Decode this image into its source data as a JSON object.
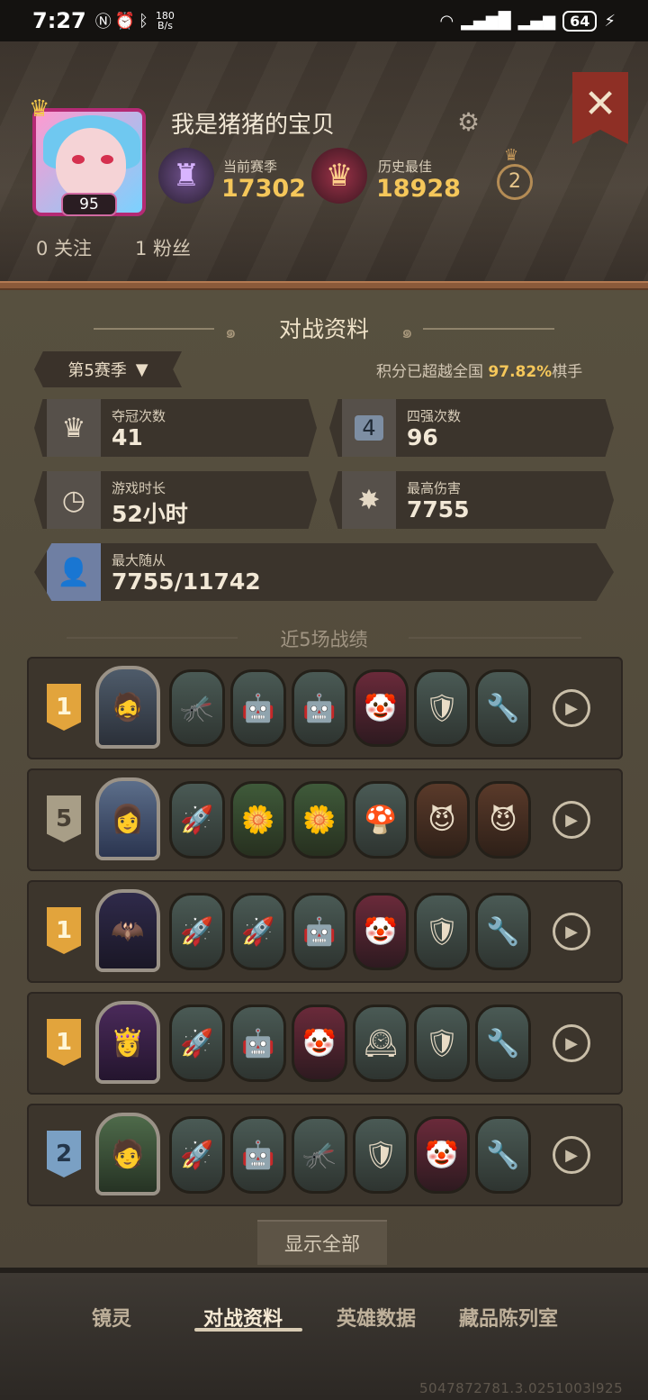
{
  "status_bar": {
    "time": "7:27",
    "network_speed_value": "180",
    "network_speed_unit": "B/s",
    "battery": "64"
  },
  "profile": {
    "username": "我是猪猪的宝贝",
    "level": "95",
    "current_season_label": "当前赛季",
    "current_season_score": "17302",
    "best_label": "历史最佳",
    "best_score": "18928",
    "battle_pass_level": "2",
    "following": "0 关注",
    "followers": "1 粉丝"
  },
  "battle_data": {
    "title": "对战资料",
    "season_selector": "第5赛季",
    "beat_prefix": "积分已超越全国",
    "beat_percent": "97.82%",
    "beat_suffix": "棋手",
    "stats": {
      "champion_label": "夺冠次数",
      "champion_value": "41",
      "top4_label": "四强次数",
      "top4_value": "96",
      "playtime_label": "游戏时长",
      "playtime_value": "52小时",
      "max_damage_label": "最高伤害",
      "max_damage_value": "7755",
      "max_minion_label": "最大随从",
      "max_minion_value": "7755/11742"
    },
    "top4_icon_digit": "4"
  },
  "recent": {
    "title": "近5场战绩",
    "matches": [
      {
        "place": "1",
        "tier": "gold"
      },
      {
        "place": "5",
        "tier": "grey"
      },
      {
        "place": "1",
        "tier": "gold"
      },
      {
        "place": "1",
        "tier": "gold"
      },
      {
        "place": "2",
        "tier": "blue"
      }
    ],
    "show_all": "显示全部"
  },
  "bottom_nav": {
    "items": [
      "镜灵",
      "对战资料",
      "英雄数据",
      "藏品陈列室"
    ],
    "active_index": 1
  },
  "watermark": "5047872781.3.0251003l925",
  "colors": {
    "accent_gold": "#f5c75a",
    "close_red": "#8e2f25",
    "avatar_frame_pink": "#b42a74"
  }
}
